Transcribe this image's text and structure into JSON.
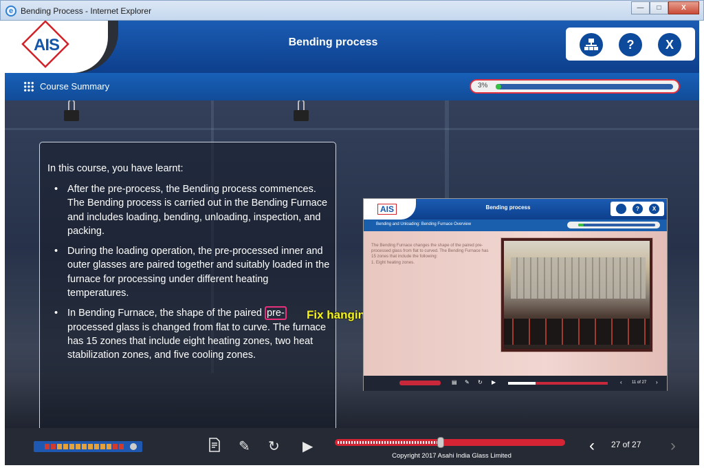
{
  "window": {
    "title": "Bending Process - Internet Explorer",
    "buttons": [
      "—",
      "□",
      "X"
    ]
  },
  "header": {
    "logo": "AIS",
    "title": "Bending process",
    "buttons": {
      "sitemap": "",
      "help": "?",
      "exit": "X"
    }
  },
  "subbar": {
    "label": "Course Summary",
    "progress_text": "3%",
    "progress_fraction": 0.03
  },
  "content": {
    "intro": "In this course, you have learnt:",
    "bullets": [
      "After the pre-process, the Bending process commences. The Bending process is carried out in the Bending Furnace and includes loading, bending, unloading, inspection, and packing.",
      "During the loading operation, the pre-processed inner and outer glasses are paired together and suitably loaded in the furnace for processing under different heating temperatures."
    ],
    "bullet3": {
      "before": "In Bending Furnace, the shape of the paired ",
      "highlight": "pre-",
      "after": " processed glass is changed from flat to curve. The furnace has 15 zones that include eight heating zones, two heat stabilization zones, and five cooling zones."
    }
  },
  "annotation": "Fix hanging hyphen issue.",
  "inset": {
    "logo": "AIS",
    "title": "Bending process",
    "buttons": [
      "",
      "?",
      "X"
    ],
    "subtitle": "Bending and Unloading: Bending Furnace Overview",
    "text": "The Bending Furnace changes the shape of the paired pre-processed glass from flat to curved. The Bending Furnace has 15 zones that include the following:",
    "list_item": "1.   Eight heating zones.",
    "pager": "11 of 27"
  },
  "bottom": {
    "copyright": "Copyright 2017 Asahi India Glass Limited",
    "pager": "27 of 27",
    "seek_fraction": 0.46
  },
  "colors": {
    "brand_blue": "#0e4a9c",
    "accent_red": "#d52434",
    "annotation_yellow": "#f2f21e",
    "highlight_pink": "#e8317a"
  }
}
